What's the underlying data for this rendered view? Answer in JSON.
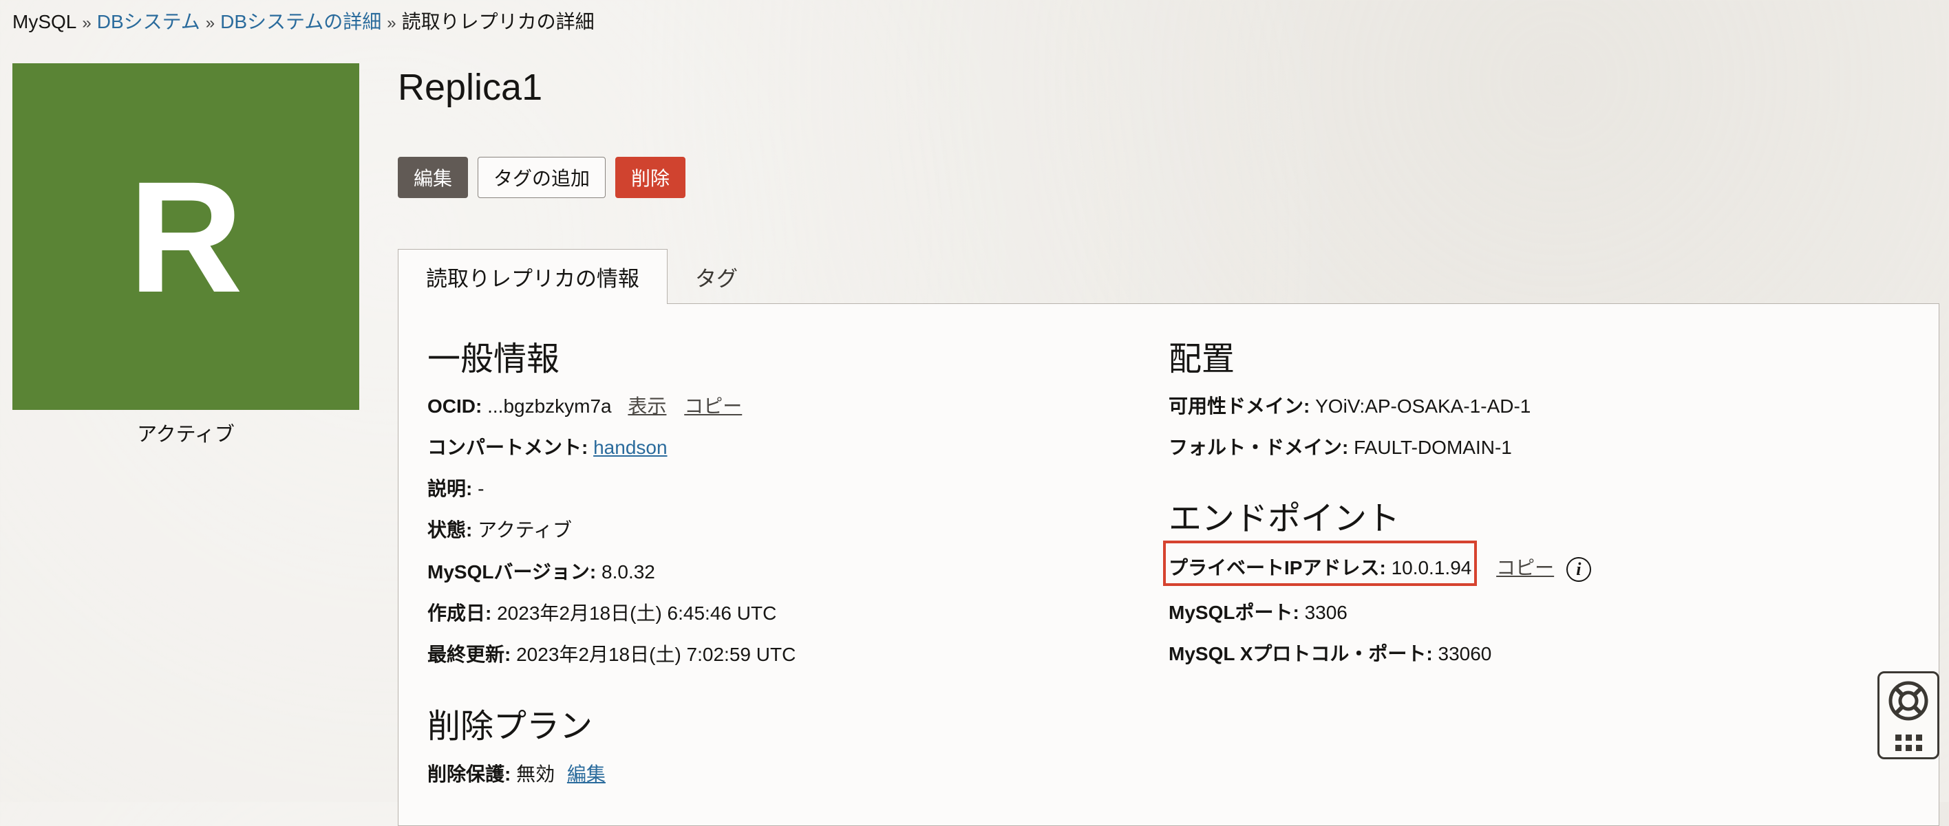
{
  "breadcrumb": {
    "root": "MySQL",
    "items": [
      "DBシステム",
      "DBシステムの詳細"
    ],
    "current": "読取りレプリカの詳細",
    "separator": "»"
  },
  "avatar": {
    "letter": "R",
    "status": "アクティブ",
    "color": "#5a8435"
  },
  "title": "Replica1",
  "actions": {
    "edit": "編集",
    "add_tags": "タグの追加",
    "delete": "削除"
  },
  "tabs": [
    {
      "label": "読取りレプリカの情報",
      "active": true
    },
    {
      "label": "タグ",
      "active": false
    }
  ],
  "general": {
    "title": "一般情報",
    "ocid_label": "OCID:",
    "ocid_value": "...bgzbzkym7a",
    "show": "表示",
    "copy": "コピー",
    "compartment_label": "コンパートメント:",
    "compartment_value": "handson",
    "description_label": "説明:",
    "description_value": "-",
    "state_label": "状態:",
    "state_value": "アクティブ",
    "version_label": "MySQLバージョン:",
    "version_value": "8.0.32",
    "created_label": "作成日:",
    "created_value": "2023年2月18日(土) 6:45:46 UTC",
    "updated_label": "最終更新:",
    "updated_value": "2023年2月18日(土) 7:02:59 UTC"
  },
  "placement": {
    "title": "配置",
    "ad_label": "可用性ドメイン:",
    "ad_value": "YOiV:AP-OSAKA-1-AD-1",
    "fd_label": "フォルト・ドメイン:",
    "fd_value": "FAULT-DOMAIN-1"
  },
  "endpoint": {
    "title": "エンドポイント",
    "ip_label": "プライベートIPアドレス:",
    "ip_value": "10.0.1.94",
    "copy": "コピー",
    "info_icon": "i",
    "port_label": "MySQLポート:",
    "port_value": "3306",
    "xport_label": "MySQL Xプロトコル・ポート:",
    "xport_value": "33060"
  },
  "deletion": {
    "title": "削除プラン",
    "protect_label": "削除保護:",
    "protect_value": "無効",
    "edit": "編集"
  },
  "colors": {
    "accent_link": "#2a6b9c",
    "delete_button": "#d0432f",
    "highlight": "#d6432f"
  },
  "icons": {
    "help_widget": "lifebuoy-icon",
    "apps": "grid-icon",
    "info": "info-icon"
  }
}
